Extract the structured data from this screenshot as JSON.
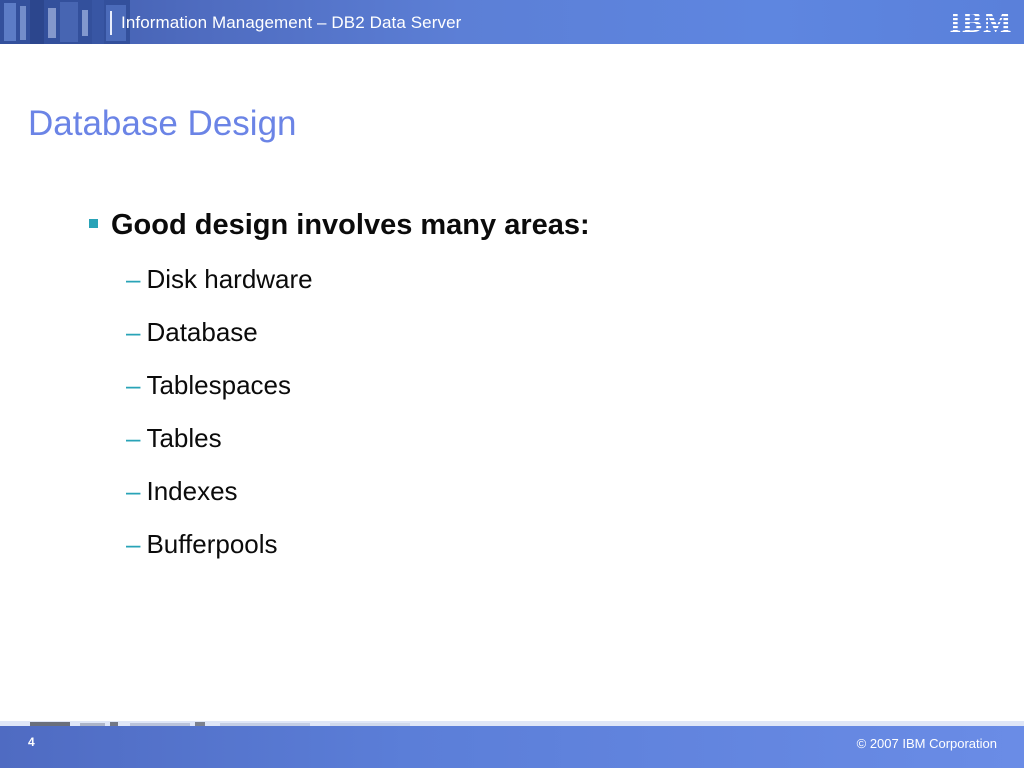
{
  "header": {
    "title": "Information Management – DB2 Data Server",
    "logo": "IBM"
  },
  "slide": {
    "title": "Database Design",
    "bullet": {
      "text": "Good design involves many areas:",
      "icon": "square-bullet-icon"
    },
    "sub_items": [
      {
        "dash": "–",
        "label": "Disk hardware"
      },
      {
        "dash": "–",
        "label": "Database"
      },
      {
        "dash": "–",
        "label": "Tablespaces"
      },
      {
        "dash": "–",
        "label": "Tables"
      },
      {
        "dash": "–",
        "label": "Indexes"
      },
      {
        "dash": "–",
        "label": "Bufferpools"
      }
    ]
  },
  "footer": {
    "page_number": "4",
    "copyright": "© 2007 IBM Corporation"
  },
  "colors": {
    "title": "#6b84e6",
    "bullet_accent": "#29a3b7",
    "banner": "#5c7fd6",
    "body_text": "#0b0b0b"
  }
}
